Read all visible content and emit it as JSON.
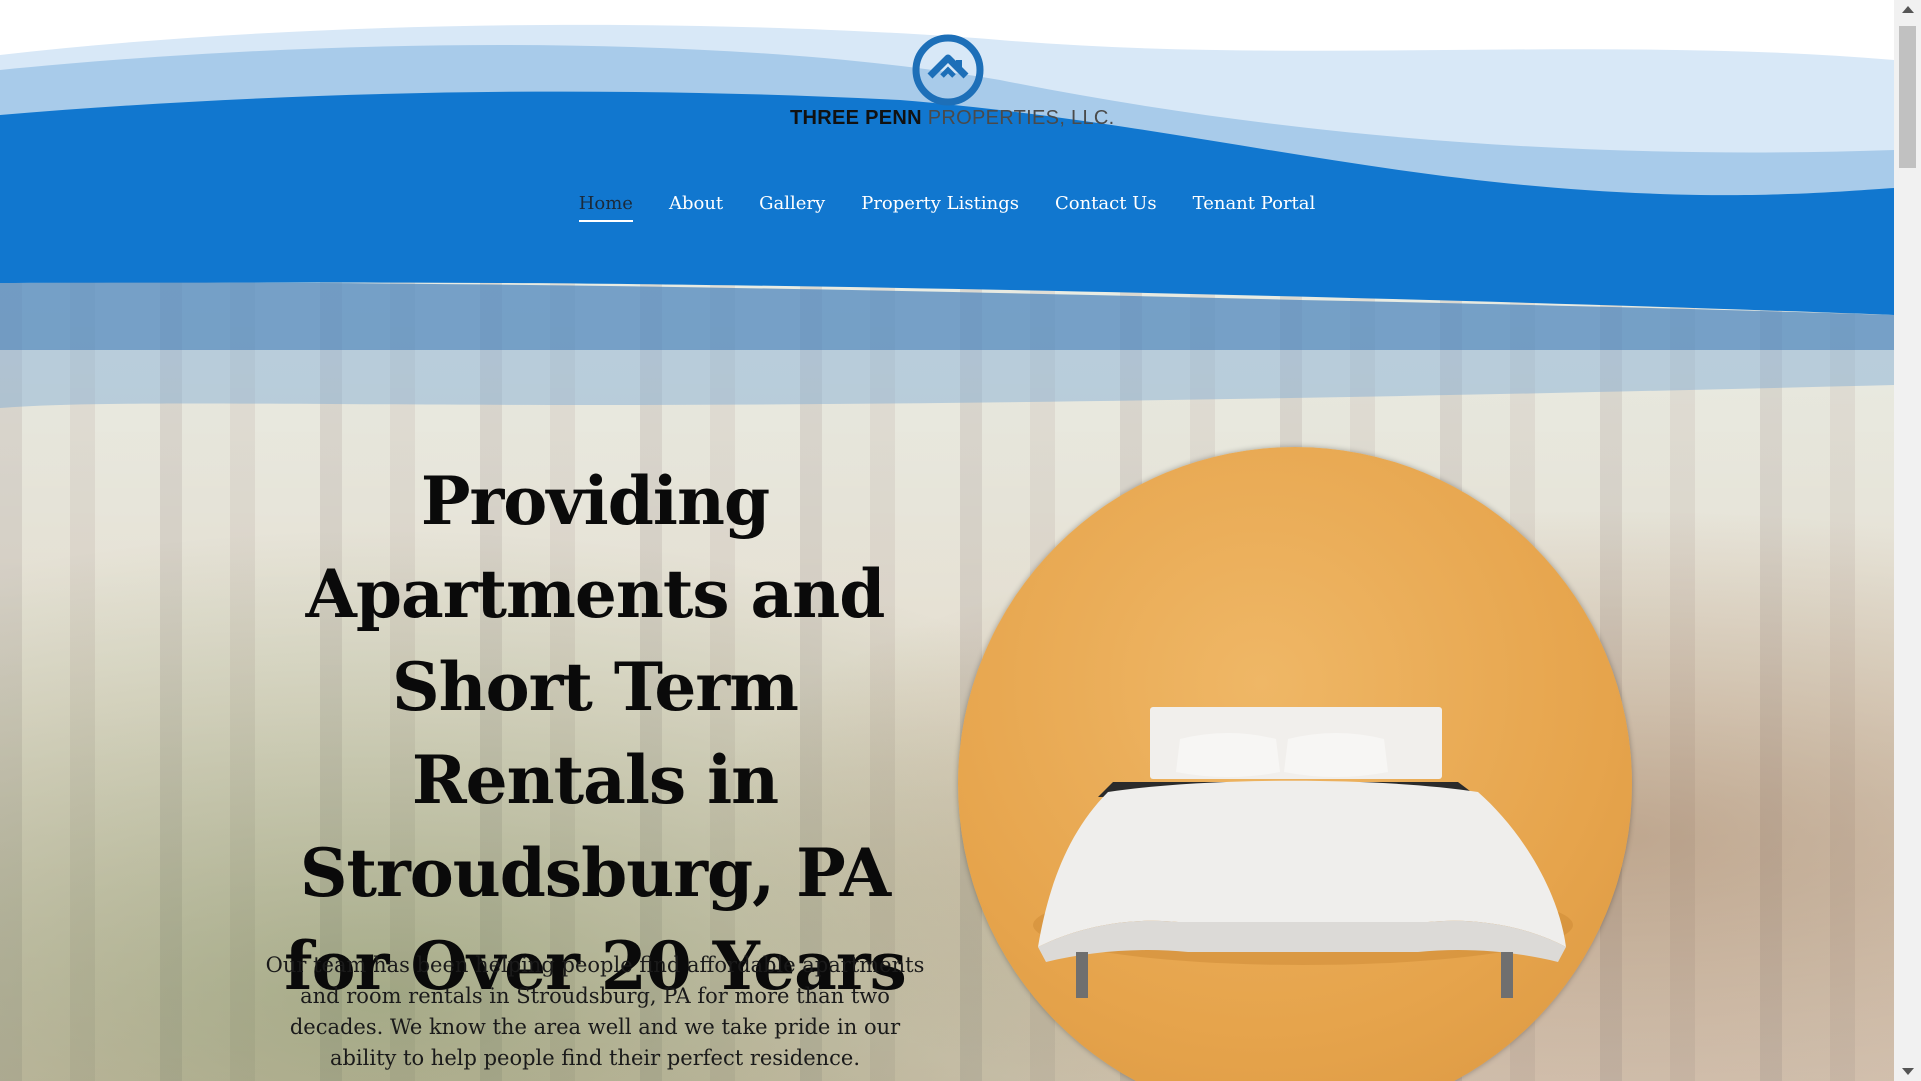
{
  "brand": {
    "name_bold": "THREE PENN",
    "name_light": " PROPERTIES, LLC.",
    "logo_icon": "house-in-circle-icon"
  },
  "nav": {
    "items": [
      {
        "label": "Home",
        "active": true
      },
      {
        "label": "About"
      },
      {
        "label": "Gallery"
      },
      {
        "label": "Property Listings"
      },
      {
        "label": "Contact Us"
      },
      {
        "label": "Tenant Portal"
      }
    ]
  },
  "hero": {
    "headline": "Providing Apartments and Short Term Rentals in Stroudsburg, PA for Over 20 Years",
    "intro": "Our team has been helping people find affordable apartments and room rentals in Stroudsburg, PA for more than two decades. We know the area well and we take pride in our ability to help people find their perfect residence.",
    "image": "bed-on-orange-background"
  },
  "colors": {
    "brand_blue": "#1177cf",
    "light_wave": "#d5e6f6",
    "mid_wave": "#a9cbea",
    "accent_orange": "#e6a44c"
  }
}
